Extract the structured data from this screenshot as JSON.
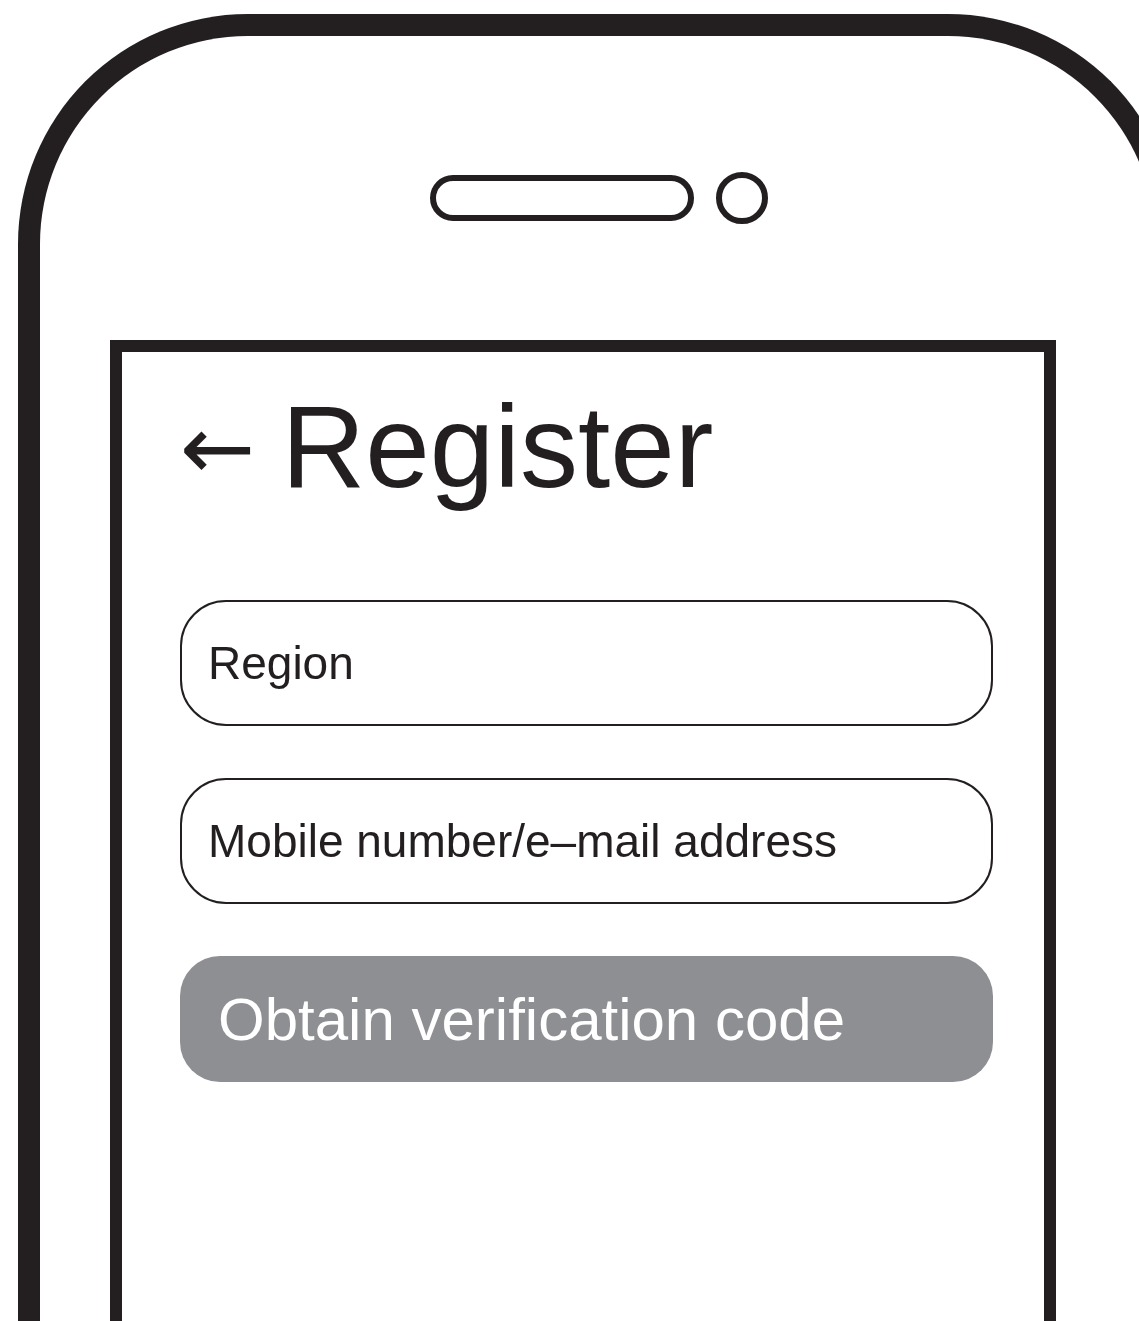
{
  "header": {
    "back": "←",
    "title": "Register"
  },
  "fields": [
    {
      "placeholder": "Region"
    },
    {
      "placeholder": "Mobile number/e–mail address"
    }
  ],
  "button": {
    "label": "Obtain verification code",
    "disabled": true
  }
}
